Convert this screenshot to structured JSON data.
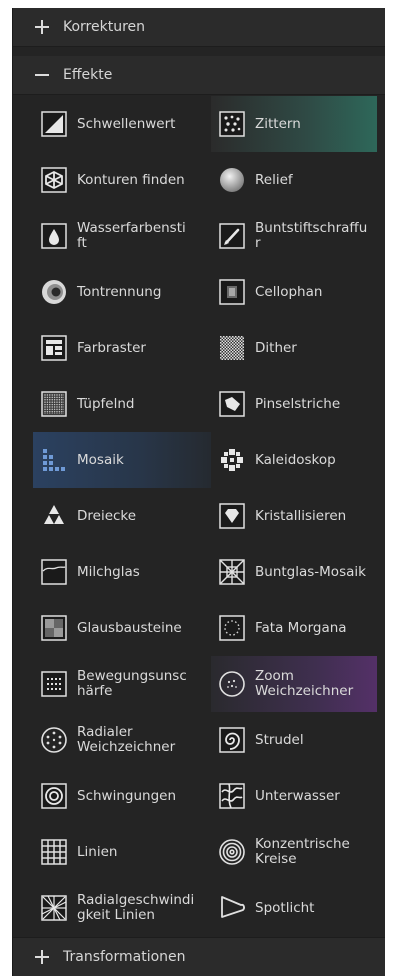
{
  "sections": {
    "korrekturen": "Korrekturen",
    "effekte": "Effekte",
    "transformationen": "Transformationen"
  },
  "effects": [
    [
      "Schwellenwert",
      "Zittern"
    ],
    [
      "Konturen finden",
      "Relief"
    ],
    [
      "Wasserfarbensti\nft",
      "Buntstiftschraffu\nr"
    ],
    [
      "Tontrennung",
      "Cellophan"
    ],
    [
      "Farbraster",
      "Dither"
    ],
    [
      "Tüpfelnd",
      "Pinselstriche"
    ],
    [
      "Mosaik",
      "Kaleidoskop"
    ],
    [
      "Dreiecke",
      "Kristallisieren"
    ],
    [
      "Milchglas",
      "Buntglas-Mosaik"
    ],
    [
      "Glausbausteine",
      "Fata Morgana"
    ],
    [
      "Bewegungsunsc\nhärfe",
      "Zoom\nWeichzeichner"
    ],
    [
      "Radialer\nWeichzeichner",
      "Strudel"
    ],
    [
      "Schwingungen",
      "Unterwasser"
    ],
    [
      "Linien",
      "Konzentrische\nKreise"
    ],
    [
      "Radialgeschwindi\ngkeit Linien",
      "Spotlicht"
    ]
  ],
  "icons": [
    [
      "threshold-icon",
      "jitter-icon"
    ],
    [
      "find-edges-icon",
      "relief-icon"
    ],
    [
      "watercolor-icon",
      "pencil-hatch-icon"
    ],
    [
      "posterize-icon",
      "cellophane-icon"
    ],
    [
      "color-halftone-icon",
      "dither-icon"
    ],
    [
      "stipple-icon",
      "brush-strokes-icon"
    ],
    [
      "mosaic-icon",
      "kaleidoscope-icon"
    ],
    [
      "triangles-icon",
      "crystallize-icon"
    ],
    [
      "frosted-glass-icon",
      "stained-glass-icon"
    ],
    [
      "glass-blocks-icon",
      "mirage-icon"
    ],
    [
      "motion-blur-icon",
      "zoom-blur-icon"
    ],
    [
      "radial-blur-icon",
      "swirl-icon"
    ],
    [
      "ripple-icon",
      "underwater-icon"
    ],
    [
      "lines-icon",
      "concentric-circles-icon"
    ],
    [
      "radial-speed-lines-icon",
      "spotlight-icon"
    ]
  ],
  "highlights": {
    "teal": "#2e6b5c",
    "blue": "#2b4160",
    "purple": "#57306b"
  }
}
